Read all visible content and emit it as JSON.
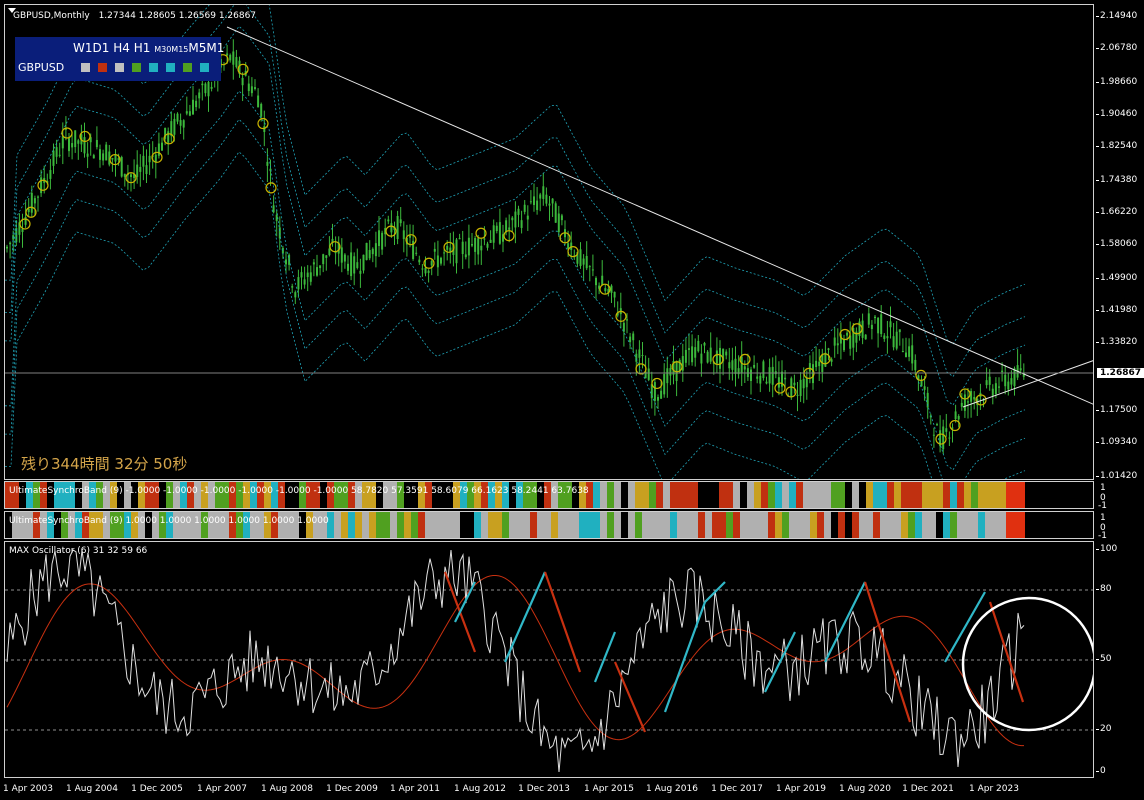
{
  "header": {
    "symbol_label": "GBPUSD,Monthly",
    "ohlc": "1.27344 1.28605 1.26569 1.26867"
  },
  "timeframes": {
    "items": [
      "W1",
      "D1",
      "H4",
      "H1",
      "M30",
      "M15",
      "M5",
      "M1"
    ],
    "symbol": "GBPUSD",
    "square_colors": [
      "#c0c0c0",
      "#c03010",
      "#c0c0c0",
      "#50a020",
      "#20b0c0",
      "#20b0c0",
      "#50a020",
      "#20b0c0"
    ]
  },
  "timer": "残り344時間 32分 50秒",
  "price_axis": [
    "2.14940",
    "2.06780",
    "1.98660",
    "1.90460",
    "1.82540",
    "1.74380",
    "1.66220",
    "1.58060",
    "1.49900",
    "1.41980",
    "1.33820",
    "1.17500",
    "1.09340",
    "1.01420"
  ],
  "current_price": "1.26867",
  "indicator1": {
    "label": "UltimateSynchroBand (9) -1.0000 -1.0000 -1.0000 -1.0000 -1.0000 -1.0000 58.7820 57.3591 58.6079 66.1623 58.2441 63.7638",
    "axis": [
      "1",
      "0",
      "-1"
    ]
  },
  "indicator2": {
    "label": "UltimateSynchroBand (9) 1.0000 1.0000 1.0000 1.0000 1.0000 1.0000",
    "axis": [
      "1",
      "0",
      "-1"
    ]
  },
  "oscillator": {
    "label": "MAX Oscillator (6) 31 32 59 66",
    "axis": [
      "100",
      "80",
      "50",
      "20",
      "0"
    ]
  },
  "time_axis": [
    "1 Apr 2003",
    "1 Aug 2004",
    "1 Dec 2005",
    "1 Apr 2007",
    "1 Aug 2008",
    "1 Dec 2009",
    "1 Apr 2011",
    "1 Aug 2012",
    "1 Dec 2013",
    "1 Apr 2015",
    "1 Aug 2016",
    "1 Dec 2017",
    "1 Apr 2019",
    "1 Aug 2020",
    "1 Dec 2021",
    "1 Apr 2023"
  ],
  "colors": {
    "candle": "#3cb93c",
    "band": "#1fa4b8",
    "circle": "#c8b400",
    "osc_red": "#c83010",
    "osc_cyan": "#30b8c8",
    "osc_white": "#e0e0e0",
    "stripe_colors": [
      "#c8a020",
      "#c03010",
      "#20b0c0",
      "#50a020",
      "#b0b0b0",
      "#000000",
      "#e03010"
    ]
  },
  "chart_data": {
    "type": "line",
    "title": "",
    "x": [
      "1 Apr 2003",
      "1 Aug 2004",
      "1 Dec 2005",
      "1 Apr 2007",
      "1 Aug 2008",
      "1 Dec 2009",
      "1 Apr 2011",
      "1 Aug 2012",
      "1 Dec 2013",
      "1 Apr 2015",
      "1 Aug 2016",
      "1 Dec 2017",
      "1 Apr 2019",
      "1 Aug 2020",
      "1 Dec 2021",
      "1 Apr 2023"
    ],
    "series": [
      {
        "values": [
          1.6,
          1.82,
          1.9,
          2.01,
          1.55,
          1.62,
          1.63,
          1.6,
          1.65,
          1.52,
          1.3,
          1.38,
          1.28,
          1.37,
          1.34,
          1.25
        ]
      }
    ],
    "ylim": [
      1.01,
      2.15
    ]
  }
}
